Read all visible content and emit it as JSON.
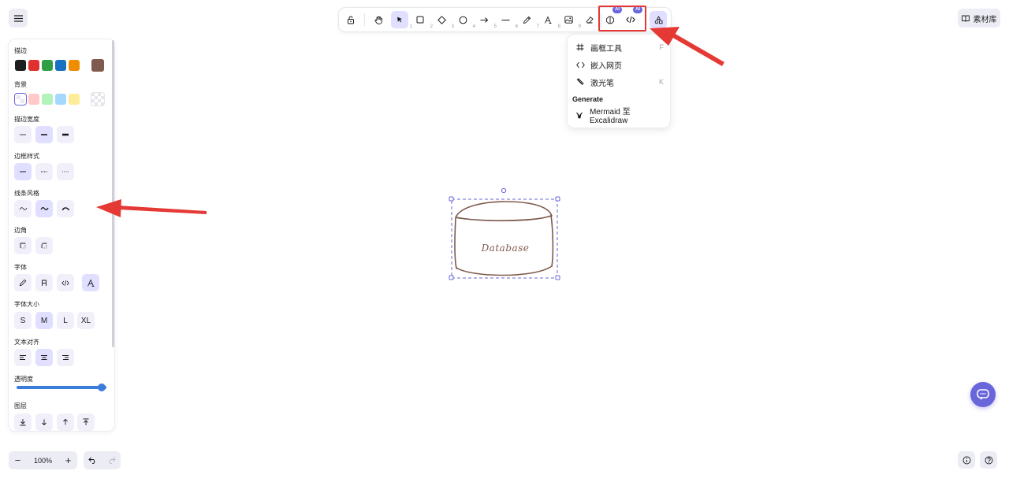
{
  "topbar": {
    "library_label": "素材库",
    "menu_icon": "hamburger-icon"
  },
  "toolbar": {
    "tools": [
      {
        "name": "lock",
        "icon": "lock-icon",
        "shortcut": ""
      },
      {
        "name": "hand",
        "icon": "hand-icon",
        "shortcut": ""
      },
      {
        "name": "selection",
        "icon": "pointer-icon",
        "shortcut": "1",
        "active": true
      },
      {
        "name": "rectangle",
        "icon": "rectangle-icon",
        "shortcut": "2"
      },
      {
        "name": "diamond",
        "icon": "diamond-icon",
        "shortcut": "3"
      },
      {
        "name": "ellipse",
        "icon": "ellipse-icon",
        "shortcut": "4"
      },
      {
        "name": "arrow",
        "icon": "arrow-icon",
        "shortcut": "5"
      },
      {
        "name": "line",
        "icon": "line-icon",
        "shortcut": "6"
      },
      {
        "name": "draw",
        "icon": "pencil-icon",
        "shortcut": "7"
      },
      {
        "name": "text",
        "icon": "text-icon",
        "shortcut": "8"
      },
      {
        "name": "image",
        "icon": "image-icon",
        "shortcut": "9"
      },
      {
        "name": "eraser",
        "icon": "eraser-icon",
        "shortcut": "0"
      },
      {
        "name": "ai-diagram",
        "icon": "brain-icon",
        "badge": "AI"
      },
      {
        "name": "ai-code",
        "icon": "code-icon",
        "badge": "AI"
      },
      {
        "name": "more-tools",
        "icon": "shapes-icon",
        "active": true
      }
    ]
  },
  "dropdown": {
    "items": [
      {
        "label": "画框工具",
        "shortcut": "F",
        "icon": "frame-icon"
      },
      {
        "label": "嵌入网页",
        "shortcut": "",
        "icon": "embed-icon"
      },
      {
        "label": "激光笔",
        "shortcut": "K",
        "icon": "laser-icon"
      }
    ],
    "section_title": "Generate",
    "generate_items": [
      {
        "label": "Mermaid 至 Excalidraw",
        "icon": "mermaid-icon"
      }
    ]
  },
  "panel": {
    "stroke_label": "描边",
    "stroke_colors": [
      "#1e1e1e",
      "#e03131",
      "#2f9e44",
      "#1971c2",
      "#f08c00"
    ],
    "stroke_current": "#7f5a4e",
    "background_label": "背景",
    "background_colors": [
      "transparent",
      "#ffc9c9",
      "#b2f2bb",
      "#a5d8ff",
      "#ffec99"
    ],
    "background_current": "transparent",
    "stroke_width_label": "描边宽度",
    "stroke_style_label": "边框样式",
    "sloppiness_label": "线条风格",
    "edges_label": "边角",
    "font_family_label": "字体",
    "font_size_label": "字体大小",
    "font_sizes": [
      "S",
      "M",
      "L",
      "XL"
    ],
    "text_align_label": "文本对齐",
    "opacity_label": "透明度",
    "opacity_value": 1.0,
    "layers_label": "图层"
  },
  "canvas": {
    "shape_label": "Database",
    "shape_color": "#7f5a4e"
  },
  "footer": {
    "zoom_value": "100%",
    "zoom_out_label": "−",
    "zoom_in_label": "+"
  }
}
